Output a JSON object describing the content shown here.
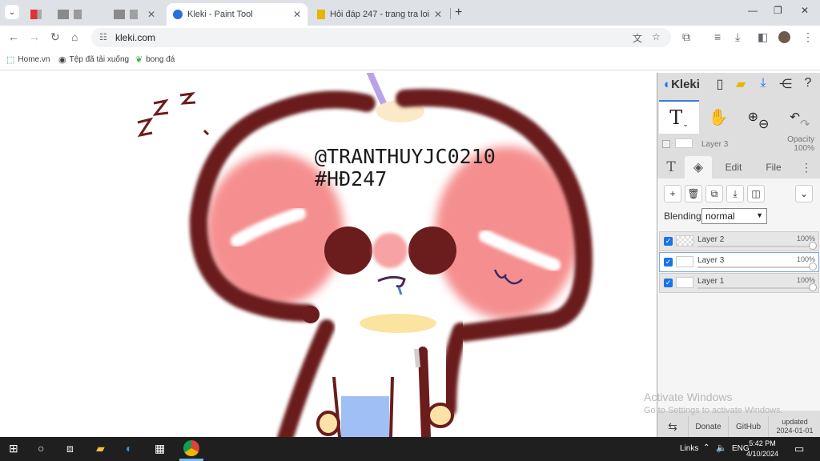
{
  "browser": {
    "tabs": [
      {
        "title": "",
        "active": false
      },
      {
        "title": "",
        "active": false
      },
      {
        "title": "",
        "active": false
      },
      {
        "title": "Kleki - Paint Tool",
        "active": true
      },
      {
        "title": "Hỏi đáp 247 - trang tra loi",
        "active": false
      }
    ],
    "url": "kleki.com",
    "bookmarks": [
      "Home.vn",
      "Tệp đã tải xuống",
      "bong đá"
    ]
  },
  "drawing": {
    "handle": "@TRANTHUYJC0210",
    "tag": "#HĐ247",
    "zzz": "z z z"
  },
  "kleki": {
    "logo": "Kleki",
    "current_layer": "Layer 3",
    "opacity_label": "Opacity",
    "opacity_value": "100%",
    "tabs": [
      "T",
      "Edit",
      "File"
    ],
    "blending_label": "Blending",
    "blending_value": "normal",
    "layers": [
      {
        "name": "Layer 2",
        "opacity": "100%",
        "selected": false
      },
      {
        "name": "Layer 3",
        "opacity": "100%",
        "selected": true
      },
      {
        "name": "Layer 1",
        "opacity": "100%",
        "selected": false
      }
    ],
    "footer": {
      "donate": "Donate",
      "github": "GitHub",
      "updated_label": "updated",
      "updated_date": "2024-01-01"
    }
  },
  "watermark": {
    "title": "Activate Windows",
    "subtitle": "Go to Settings to activate Windows."
  },
  "taskbar": {
    "links": "Links",
    "lang": "ENG",
    "time": "5:42 PM",
    "date": "4/10/2024"
  },
  "colors": {
    "accent": "#1a73e8",
    "outline": "#6b1c1c",
    "cheek": "#f58f8f",
    "taskbar": "#1f1f1f"
  }
}
